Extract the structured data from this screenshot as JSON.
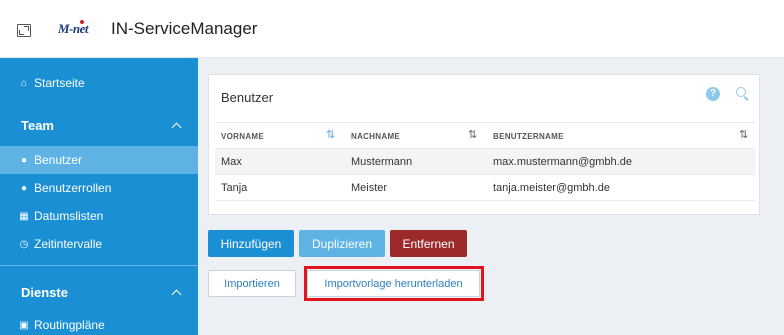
{
  "header": {
    "logo_text": "M-net",
    "app_title": "IN-ServiceManager",
    "icons": [
      "window-toggle-icon"
    ]
  },
  "sidebar": {
    "home": {
      "label": "Startseite",
      "icon": "home-icon"
    },
    "sections": [
      {
        "title": "Team",
        "items": [
          {
            "label": "Benutzer",
            "icon": "user-icon",
            "active": true
          },
          {
            "label": "Benutzerrollen",
            "icon": "users-icon",
            "active": false
          },
          {
            "label": "Datumslisten",
            "icon": "calendar-icon",
            "active": false
          },
          {
            "label": "Zeitintervalle",
            "icon": "clock-icon",
            "active": false
          }
        ]
      },
      {
        "title": "Dienste",
        "items": [
          {
            "label": "Routingpläne",
            "icon": "sitemap-icon",
            "active": false
          }
        ]
      }
    ]
  },
  "panel": {
    "title": "Benutzer",
    "columns": [
      "VORNAME",
      "NACHNAME",
      "BENUTZERNAME"
    ],
    "rows": [
      {
        "vorname": "Max",
        "nachname": "Mustermann",
        "benutzername": "max.mustermann@gmbh.de"
      },
      {
        "vorname": "Tanja",
        "nachname": "Meister",
        "benutzername": "tanja.meister@gmbh.de"
      }
    ]
  },
  "actions": {
    "add": "Hinzufügen",
    "duplicate": "Duplizieren",
    "remove": "Entfernen",
    "import": "Importieren",
    "download_template": "Importvorlage herunterladen"
  },
  "colors": {
    "sidebar": "#1a8fd3",
    "sidebar_active": "#5fb3e4",
    "remove_button": "#9c2a2b",
    "highlight": "#e3141d"
  }
}
